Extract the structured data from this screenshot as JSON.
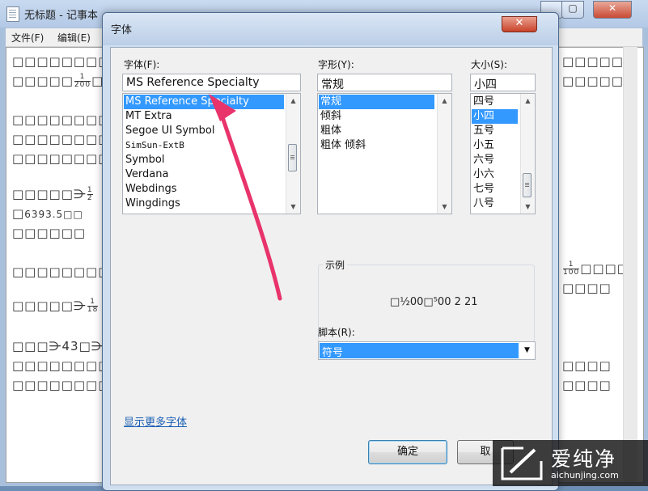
{
  "notepad": {
    "title": "无标题 - 记事本",
    "menus": [
      "文件(F)",
      "编辑(E)"
    ],
    "window_controls": {
      "minimize_icon": "minimize-icon",
      "maximize_icon": "maximize-icon",
      "close_icon": "close-icon"
    },
    "lines_left": [
      "□□□□□□□□",
      "□□□□□",
      "□□□□□□□□",
      "□□□□□□□□",
      "□□□□□□□□",
      "□□□□□⋺",
      "□",
      "□□□□□□",
      "□□□□□□□□",
      "□□□□□⋺",
      "□□□⋺43□⋺",
      "□□□□□□□□",
      "□□□□□□□□"
    ],
    "fractions": {
      "f1": [
        "1",
        "200"
      ],
      "f2": [
        "1",
        "2"
      ],
      "f3": [
        "1",
        "18"
      ]
    },
    "line6_text": "6393.5□□",
    "lines_right": [
      "□□□□□□",
      "□□□□□□",
      "□□□□",
      "□□□□",
      "□□□□",
      "□□□□"
    ],
    "right_fraction": [
      "1",
      "100"
    ]
  },
  "dialog": {
    "title": "字体",
    "font_label": "字体(F):",
    "font_value": "MS Reference Specialty",
    "fonts": [
      "MS Reference Specialty",
      "MT Extra",
      "Segoe UI Symbol",
      "SimSun-ExtB",
      "Symbol",
      "Verdana",
      "Webdings",
      "Wingdings"
    ],
    "selected_font": "MS Reference Specialty",
    "style_label": "字形(Y):",
    "style_value": "常规",
    "styles": [
      "常规",
      "倾斜",
      "粗体",
      "粗体 倾斜"
    ],
    "selected_style": "常规",
    "size_label": "大小(S):",
    "size_value": "小四",
    "sizes": [
      "四号",
      "小四",
      "五号",
      "小五",
      "六号",
      "小六",
      "七号",
      "八号"
    ],
    "selected_size": "小四",
    "sample_label": "示例",
    "sample_text": "□½00□⁵00 2 21",
    "script_label": "脚本(R):",
    "script_value": "符号",
    "more_fonts_link": "显示更多字体",
    "ok_label": "确定",
    "cancel_label": "取"
  },
  "watermark": {
    "text": "爱纯净",
    "url": "aichunjing.com"
  },
  "colors": {
    "selection": "#3399ff",
    "arrow": "#e8336b",
    "link": "#1a5fb4"
  }
}
